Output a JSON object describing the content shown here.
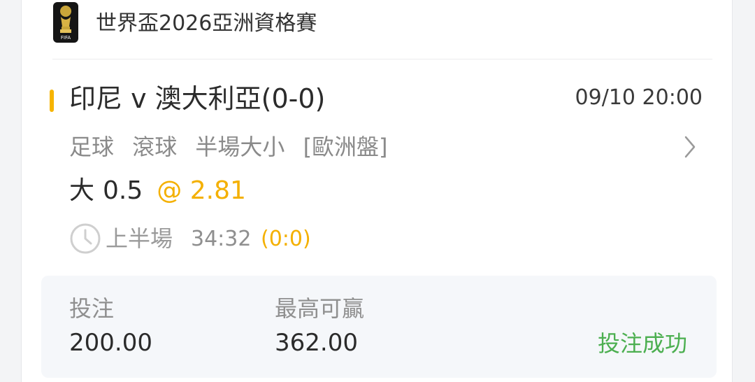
{
  "league": {
    "name": "世界盃2026亞洲資格賽",
    "logo": "fifa-world-cup-trophy"
  },
  "match": {
    "title": "印尼 v 澳大利亞(0-0)",
    "datetime": "09/10 20:00"
  },
  "market": {
    "sport": "足球",
    "mode": "滾球",
    "type": "半場大小",
    "odds_format": "[歐洲盤]"
  },
  "selection": {
    "name": "大",
    "line": "0.5",
    "odds": "@ 2.81"
  },
  "live": {
    "period": "上半場",
    "clock": "34:32",
    "score": "(0:0)"
  },
  "footer": {
    "stake_label": "投注",
    "stake_value": "200.00",
    "max_win_label": "最高可贏",
    "max_win_value": "362.00",
    "status": "投注成功"
  },
  "colors": {
    "accent": "#f6b400",
    "odds": "#f4b000",
    "success": "#4caf50",
    "muted": "#8f8f8f"
  }
}
